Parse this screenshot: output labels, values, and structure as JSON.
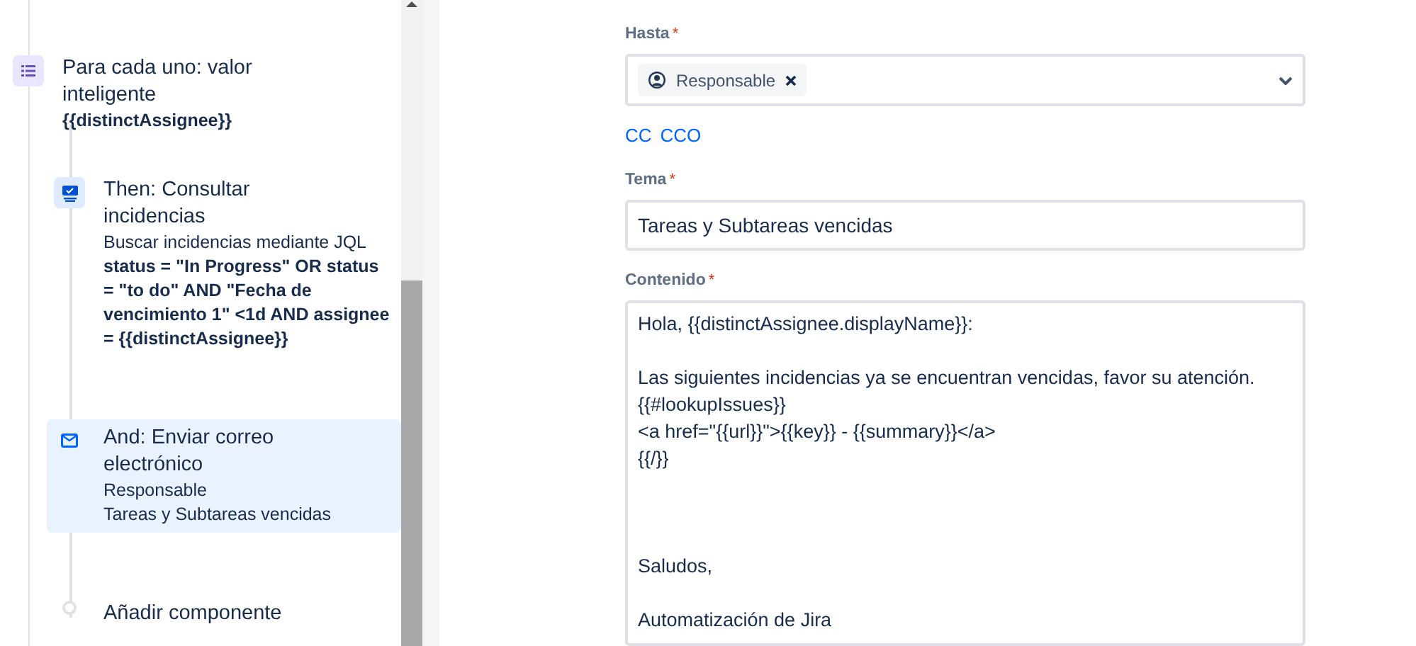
{
  "sidebar": {
    "steps": [
      {
        "kind": "branch",
        "title": "Para cada uno: valor inteligente",
        "lines": [
          {
            "text": "{{distinctAssignee}}",
            "bold": true
          }
        ],
        "selected": false
      },
      {
        "kind": "search",
        "title": "Then: Consultar incidencias",
        "lines": [
          {
            "text": "Buscar incidencias mediante JQL",
            "bold": false
          },
          {
            "text": "status = \"In Progress\" OR status = \"to do\" AND \"Fecha de vencimiento 1\" <1d AND assignee = {{distinctAssignee}}",
            "bold": true
          }
        ],
        "selected": false
      },
      {
        "kind": "email",
        "title": "And: Enviar correo electrónico",
        "lines": [
          {
            "text": "Responsable",
            "bold": false
          },
          {
            "text": "Tareas y Subtareas vencidas",
            "bold": false
          }
        ],
        "selected": true
      },
      {
        "kind": "add",
        "title": "Añadir componente",
        "selected": false
      }
    ]
  },
  "form": {
    "to": {
      "label": "Hasta",
      "required_mark": "*",
      "chips": [
        "Responsable"
      ]
    },
    "links": [
      "CC",
      "CCO"
    ],
    "subject": {
      "label": "Tema",
      "required_mark": "*",
      "value": "Tareas y Subtareas vencidas"
    },
    "content": {
      "label": "Contenido",
      "required_mark": "*",
      "value": "Hola, {{distinctAssignee.displayName}}:\n\nLas siguientes incidencias ya se encuentran vencidas, favor su atención.\n{{#lookupIssues}}\n<a href=\"{{url}}\">{{key}} - {{summary}}</a>\n{{/}}\n\n\n\nSaludos,\n\nAutomatización de Jira"
    }
  }
}
